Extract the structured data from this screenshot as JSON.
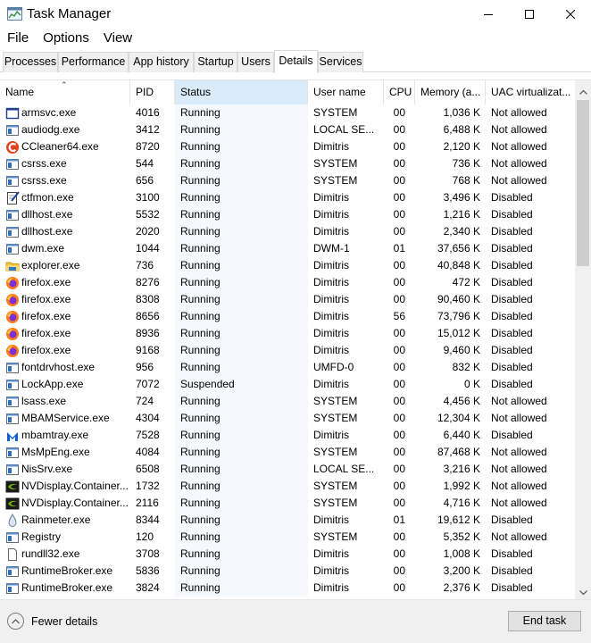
{
  "window": {
    "title": "Task Manager"
  },
  "menu": [
    "File",
    "Options",
    "View"
  ],
  "tabs": [
    "Processes",
    "Performance",
    "App history",
    "Startup",
    "Users",
    "Details",
    "Services"
  ],
  "active_tab": "Details",
  "columns": {
    "name": "Name",
    "pid": "PID",
    "status": "Status",
    "user": "User name",
    "cpu": "CPU",
    "memory": "Memory (a...",
    "uac": "UAC virtualizat..."
  },
  "processes": [
    {
      "name": "armsvc.exe",
      "pid": "4016",
      "status": "Running",
      "user": "SYSTEM",
      "cpu": "00",
      "memory": "1,036 K",
      "uac": "Not allowed",
      "icon": "window-app-icon"
    },
    {
      "name": "audiodg.exe",
      "pid": "3412",
      "status": "Running",
      "user": "LOCAL SE...",
      "cpu": "00",
      "memory": "6,488 K",
      "uac": "Not allowed",
      "icon": "system-process-icon"
    },
    {
      "name": "CCleaner64.exe",
      "pid": "8720",
      "status": "Running",
      "user": "Dimitris",
      "cpu": "00",
      "memory": "2,120 K",
      "uac": "Not allowed",
      "icon": "ccleaner-icon"
    },
    {
      "name": "csrss.exe",
      "pid": "544",
      "status": "Running",
      "user": "SYSTEM",
      "cpu": "00",
      "memory": "736 K",
      "uac": "Not allowed",
      "icon": "system-process-icon"
    },
    {
      "name": "csrss.exe",
      "pid": "656",
      "status": "Running",
      "user": "SYSTEM",
      "cpu": "00",
      "memory": "768 K",
      "uac": "Not allowed",
      "icon": "system-process-icon"
    },
    {
      "name": "ctfmon.exe",
      "pid": "3100",
      "status": "Running",
      "user": "Dimitris",
      "cpu": "00",
      "memory": "3,496 K",
      "uac": "Disabled",
      "icon": "notepad-pen-icon"
    },
    {
      "name": "dllhost.exe",
      "pid": "5532",
      "status": "Running",
      "user": "Dimitris",
      "cpu": "00",
      "memory": "1,216 K",
      "uac": "Disabled",
      "icon": "system-process-icon"
    },
    {
      "name": "dllhost.exe",
      "pid": "2020",
      "status": "Running",
      "user": "Dimitris",
      "cpu": "00",
      "memory": "2,340 K",
      "uac": "Disabled",
      "icon": "system-process-icon"
    },
    {
      "name": "dwm.exe",
      "pid": "1044",
      "status": "Running",
      "user": "DWM-1",
      "cpu": "01",
      "memory": "37,656 K",
      "uac": "Disabled",
      "icon": "system-process-icon"
    },
    {
      "name": "explorer.exe",
      "pid": "736",
      "status": "Running",
      "user": "Dimitris",
      "cpu": "00",
      "memory": "40,848 K",
      "uac": "Disabled",
      "icon": "folder-icon"
    },
    {
      "name": "firefox.exe",
      "pid": "8276",
      "status": "Running",
      "user": "Dimitris",
      "cpu": "00",
      "memory": "472 K",
      "uac": "Disabled",
      "icon": "firefox-icon"
    },
    {
      "name": "firefox.exe",
      "pid": "8308",
      "status": "Running",
      "user": "Dimitris",
      "cpu": "00",
      "memory": "90,460 K",
      "uac": "Disabled",
      "icon": "firefox-icon"
    },
    {
      "name": "firefox.exe",
      "pid": "8656",
      "status": "Running",
      "user": "Dimitris",
      "cpu": "56",
      "memory": "73,796 K",
      "uac": "Disabled",
      "icon": "firefox-icon"
    },
    {
      "name": "firefox.exe",
      "pid": "8936",
      "status": "Running",
      "user": "Dimitris",
      "cpu": "00",
      "memory": "15,012 K",
      "uac": "Disabled",
      "icon": "firefox-icon"
    },
    {
      "name": "firefox.exe",
      "pid": "9168",
      "status": "Running",
      "user": "Dimitris",
      "cpu": "00",
      "memory": "9,460 K",
      "uac": "Disabled",
      "icon": "firefox-icon"
    },
    {
      "name": "fontdrvhost.exe",
      "pid": "956",
      "status": "Running",
      "user": "UMFD-0",
      "cpu": "00",
      "memory": "832 K",
      "uac": "Disabled",
      "icon": "system-process-icon"
    },
    {
      "name": "LockApp.exe",
      "pid": "7072",
      "status": "Suspended",
      "user": "Dimitris",
      "cpu": "00",
      "memory": "0 K",
      "uac": "Disabled",
      "icon": "system-process-icon"
    },
    {
      "name": "lsass.exe",
      "pid": "724",
      "status": "Running",
      "user": "SYSTEM",
      "cpu": "00",
      "memory": "4,456 K",
      "uac": "Not allowed",
      "icon": "system-process-icon"
    },
    {
      "name": "MBAMService.exe",
      "pid": "4304",
      "status": "Running",
      "user": "SYSTEM",
      "cpu": "00",
      "memory": "12,304 K",
      "uac": "Not allowed",
      "icon": "system-process-icon"
    },
    {
      "name": "mbamtray.exe",
      "pid": "7528",
      "status": "Running",
      "user": "Dimitris",
      "cpu": "00",
      "memory": "6,440 K",
      "uac": "Disabled",
      "icon": "malwarebytes-icon"
    },
    {
      "name": "MsMpEng.exe",
      "pid": "4084",
      "status": "Running",
      "user": "SYSTEM",
      "cpu": "00",
      "memory": "87,468 K",
      "uac": "Not allowed",
      "icon": "system-process-icon"
    },
    {
      "name": "NisSrv.exe",
      "pid": "6508",
      "status": "Running",
      "user": "LOCAL SE...",
      "cpu": "00",
      "memory": "3,216 K",
      "uac": "Not allowed",
      "icon": "system-process-icon"
    },
    {
      "name": "NVDisplay.Container...",
      "pid": "1732",
      "status": "Running",
      "user": "SYSTEM",
      "cpu": "00",
      "memory": "1,992 K",
      "uac": "Not allowed",
      "icon": "nvidia-icon"
    },
    {
      "name": "NVDisplay.Container...",
      "pid": "2116",
      "status": "Running",
      "user": "SYSTEM",
      "cpu": "00",
      "memory": "4,716 K",
      "uac": "Not allowed",
      "icon": "nvidia-icon"
    },
    {
      "name": "Rainmeter.exe",
      "pid": "8344",
      "status": "Running",
      "user": "Dimitris",
      "cpu": "01",
      "memory": "19,612 K",
      "uac": "Disabled",
      "icon": "rainmeter-drop-icon"
    },
    {
      "name": "Registry",
      "pid": "120",
      "status": "Running",
      "user": "SYSTEM",
      "cpu": "00",
      "memory": "5,352 K",
      "uac": "Not allowed",
      "icon": "system-process-icon"
    },
    {
      "name": "rundll32.exe",
      "pid": "3708",
      "status": "Running",
      "user": "Dimitris",
      "cpu": "00",
      "memory": "1,008 K",
      "uac": "Disabled",
      "icon": "blank-document-icon"
    },
    {
      "name": "RuntimeBroker.exe",
      "pid": "5836",
      "status": "Running",
      "user": "Dimitris",
      "cpu": "00",
      "memory": "3,200 K",
      "uac": "Disabled",
      "icon": "system-process-icon"
    },
    {
      "name": "RuntimeBroker.exe",
      "pid": "3824",
      "status": "Running",
      "user": "Dimitris",
      "cpu": "00",
      "memory": "2,376 K",
      "uac": "Disabled",
      "icon": "system-process-icon"
    }
  ],
  "footer": {
    "fewer_details": "Fewer details",
    "end_task": "End task"
  }
}
